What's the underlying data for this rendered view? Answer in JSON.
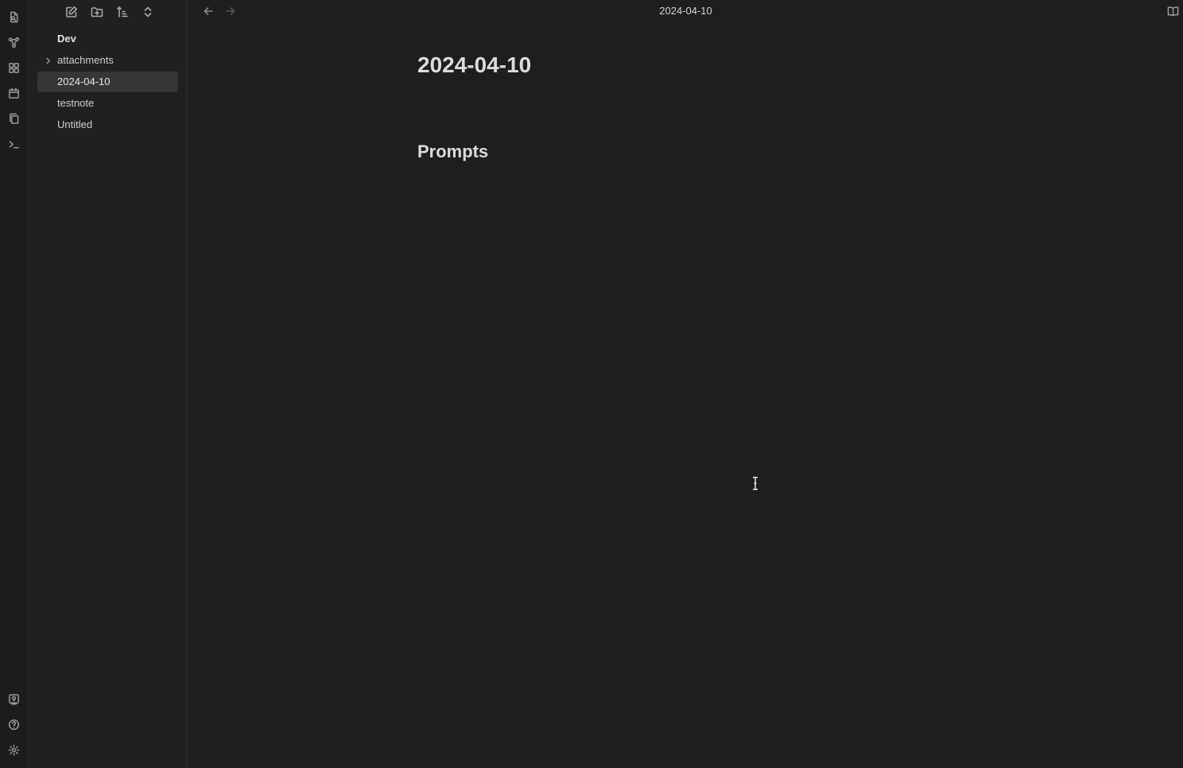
{
  "ribbon": {
    "top_icons": [
      "open-quick-switcher-icon",
      "graph-view-icon",
      "canvas-icon",
      "daily-note-calendar-icon",
      "templates-copy-icon",
      "terminal-command-palette-icon"
    ],
    "bottom_icons": [
      "vault-switcher-icon",
      "help-icon",
      "settings-gear-icon"
    ]
  },
  "sidebar": {
    "toolbar_icons": [
      "new-note-icon",
      "new-folder-icon",
      "sort-order-icon",
      "collapse-expand-icon"
    ],
    "vault_name": "Dev",
    "items": [
      {
        "label": "attachments",
        "type": "folder",
        "expanded": false
      },
      {
        "label": "2024-04-10",
        "type": "file",
        "active": true
      },
      {
        "label": "testnote",
        "type": "file"
      },
      {
        "label": "Untitled",
        "type": "file"
      }
    ]
  },
  "header": {
    "title": "2024-04-10"
  },
  "editor": {
    "inline_title": "2024-04-10",
    "heading": "Prompts"
  },
  "colors": {
    "background": "#1e1e1e",
    "sidebar": "#202020",
    "ribbon": "#1c1c1c",
    "active_item": "#363636",
    "text": "#dadada"
  }
}
